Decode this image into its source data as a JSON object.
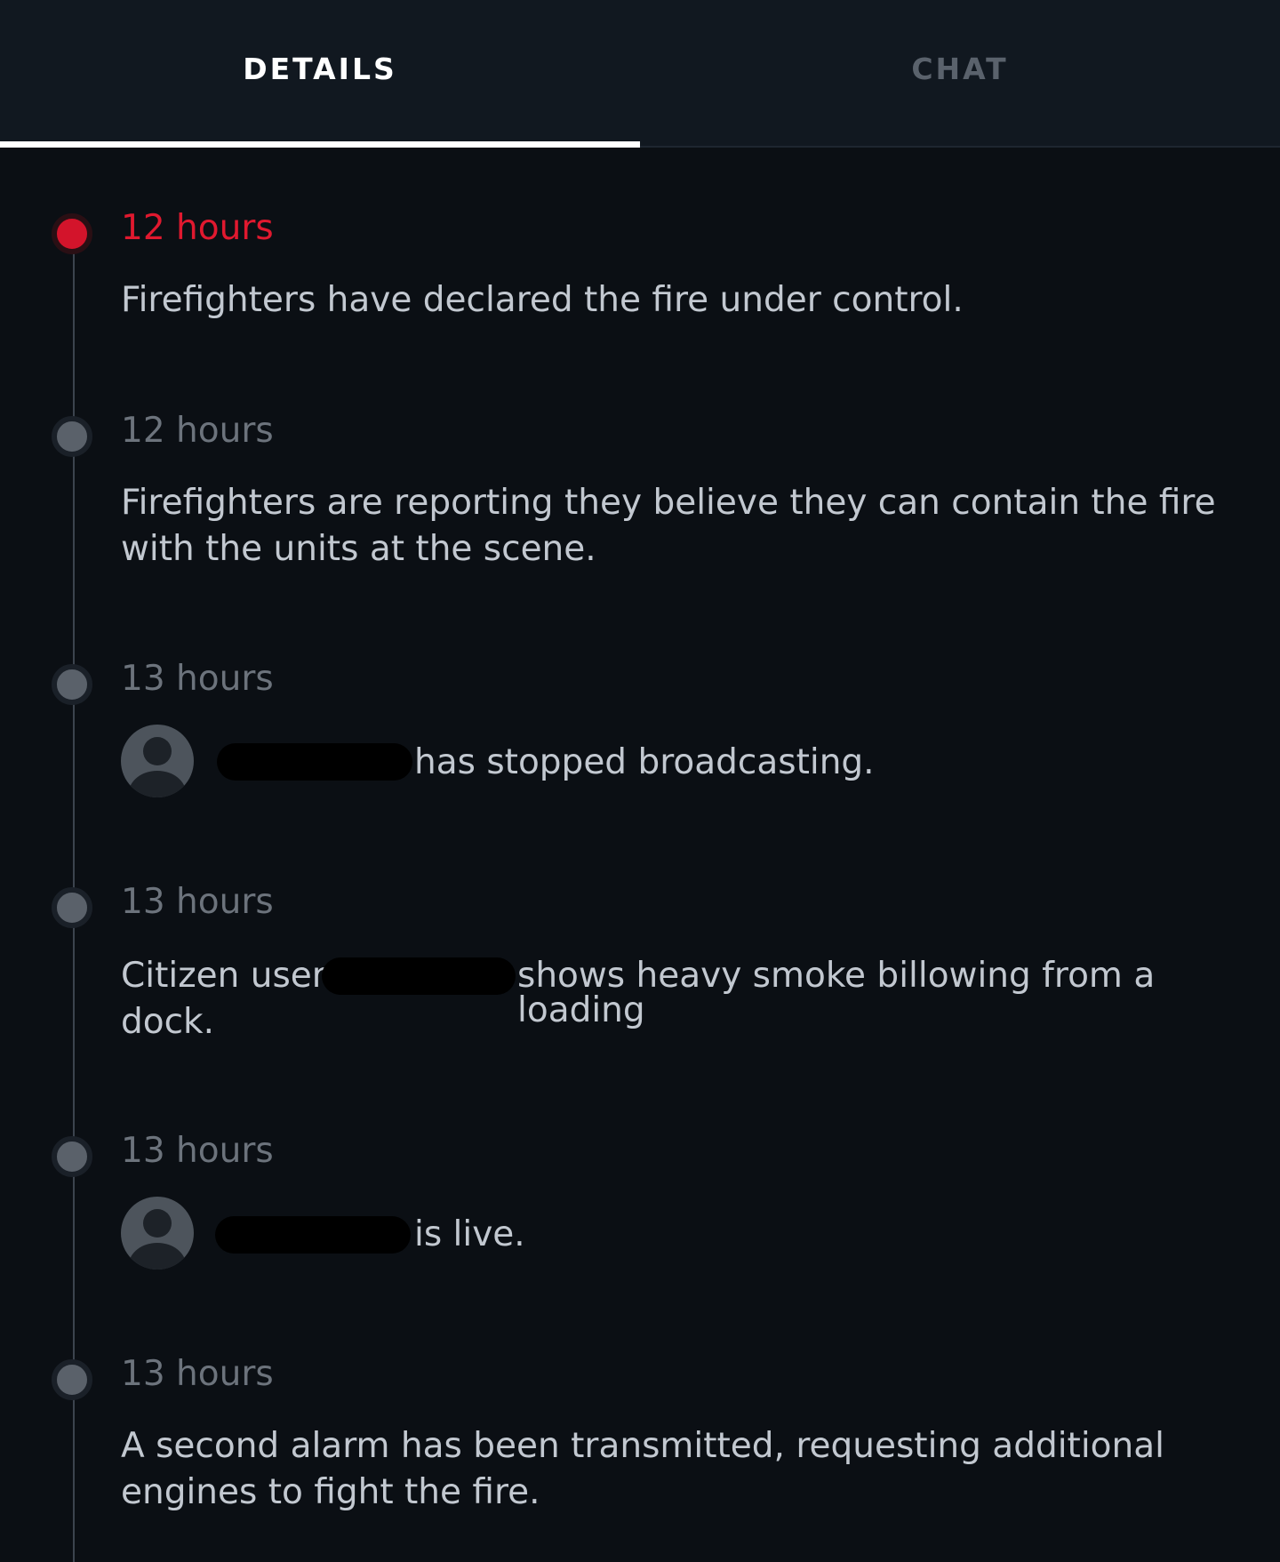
{
  "tabs": [
    {
      "label": "DETAILS",
      "active": true
    },
    {
      "label": "CHAT",
      "active": false
    }
  ],
  "timeline": [
    {
      "time": "12 hours",
      "text": "Firefighters have declared the fire under control."
    },
    {
      "time": "12 hours",
      "text": "Firefighters are reporting they believe they can contain the fire with the units at the scene."
    },
    {
      "time": "13 hours",
      "text_after": "has stopped broadcasting."
    },
    {
      "time": "13 hours",
      "text_before": "Citizen user",
      "text_after": "shows heavy smoke billowing from a loading",
      "text_line2": "dock."
    },
    {
      "time": "13 hours",
      "text_after": "is live."
    },
    {
      "time": "13 hours",
      "text": "A second alarm has been transmitted, requesting additional engines to fight the fire."
    }
  ],
  "colors": {
    "background": "#0b0f14",
    "active_accent": "#e0192f",
    "muted": "#6c737c"
  }
}
